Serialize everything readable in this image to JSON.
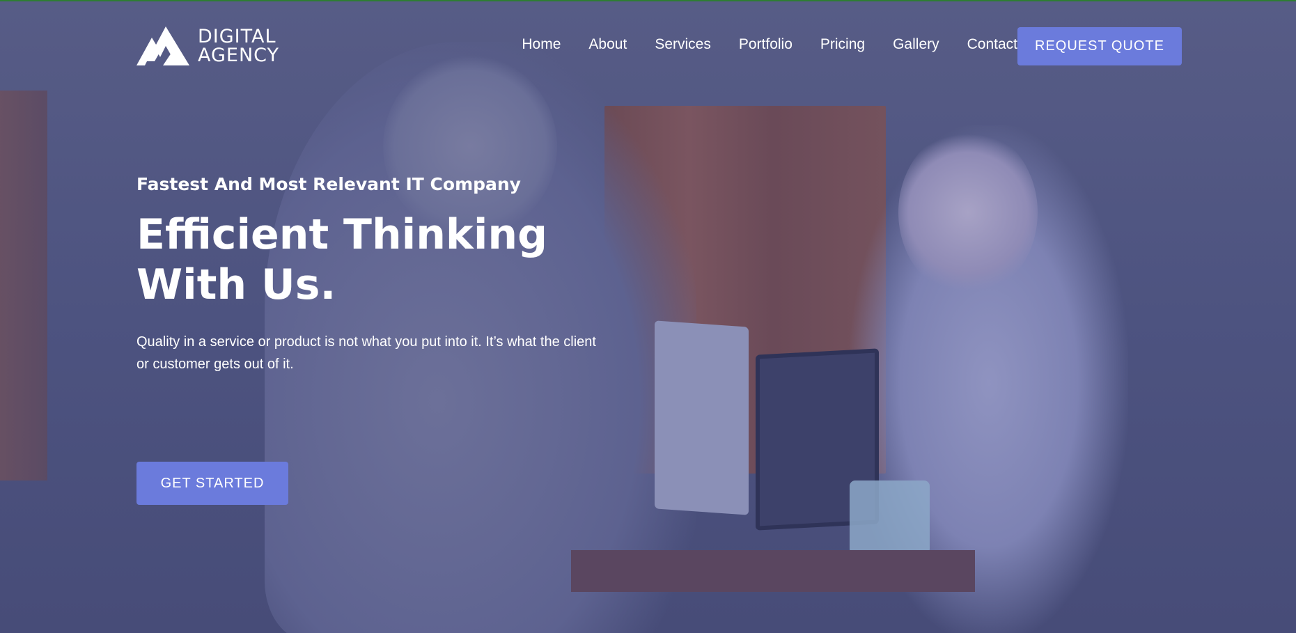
{
  "brand": {
    "logo_line1": "DIGITAL",
    "logo_line2": "AGENCY",
    "accent_color": "#6b7bdc"
  },
  "nav": {
    "items": [
      {
        "label": "Home"
      },
      {
        "label": "About"
      },
      {
        "label": "Services"
      },
      {
        "label": "Portfolio"
      },
      {
        "label": "Pricing"
      },
      {
        "label": "Gallery"
      },
      {
        "label": "Contact"
      }
    ],
    "cta_label": "REQUEST QUOTE"
  },
  "hero": {
    "kicker": "Fastest And Most Relevant IT Company",
    "headline_line1": "Efficient Thinking",
    "headline_line2": "With Us.",
    "description": "Quality in a service or product is not what you put into it. It’s what the client or customer gets out of it.",
    "cta_label": "GET STARTED"
  },
  "icons": {
    "logo_mark": "mountain-logo-icon"
  }
}
